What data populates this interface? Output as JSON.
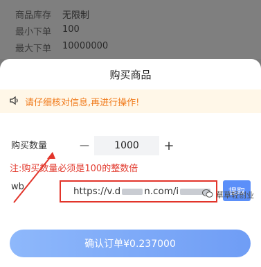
{
  "background_info": {
    "rows": [
      {
        "label": "商品库存",
        "value": "无限制"
      },
      {
        "label": "最小下单",
        "value": "100"
      },
      {
        "label": "最大下单",
        "value": "10000000"
      }
    ]
  },
  "sheet": {
    "title": "购买商品",
    "notice": "请仔细核对信息,再进行操作!",
    "quantity_label": "购买数量",
    "quantity_value": "1000",
    "minus_label": "—",
    "plus_label": "+",
    "hint": "注:购买数量必须是100的整数倍",
    "link_label": "wb",
    "link_value_start": "https://v.d",
    "link_value_mid": "n.com/i",
    "fetch_label": "提取",
    "confirm_label": "确认订单¥0.237000"
  },
  "watermark": {
    "text": "草草轻创业"
  },
  "colors": {
    "accent": "#5b8ff9",
    "notice_text": "#f07a1a",
    "hint_text": "#e23a2e",
    "highlight_border": "#e2342a"
  }
}
